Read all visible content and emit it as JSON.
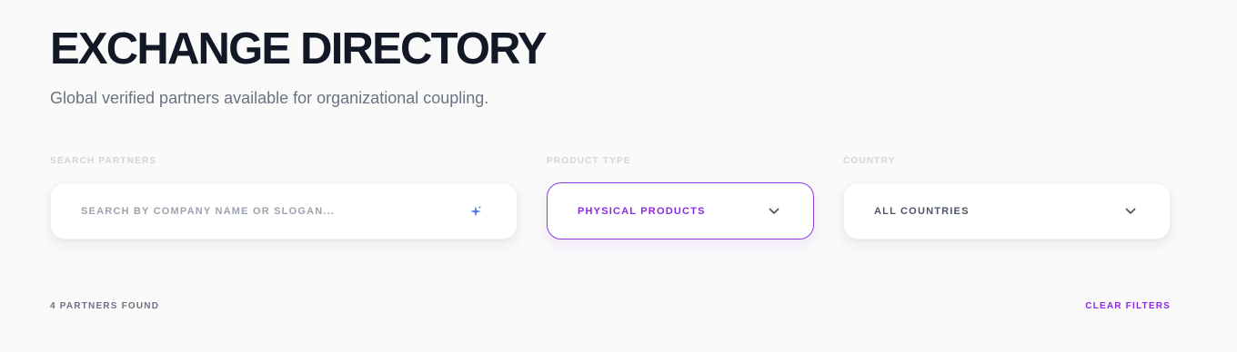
{
  "header": {
    "title": "EXCHANGE DIRECTORY",
    "subtitle": "Global verified partners available for organizational coupling."
  },
  "filters": {
    "search": {
      "label": "SEARCH PARTNERS",
      "placeholder": "SEARCH BY COMPANY NAME OR SLOGAN...",
      "icon": "sparkle-icon"
    },
    "product_type": {
      "label": "PRODUCT TYPE",
      "selected": "PHYSICAL PRODUCTS",
      "icon": "chevron-down-icon"
    },
    "country": {
      "label": "COUNTRY",
      "selected": "ALL COUNTRIES",
      "icon": "chevron-down-icon"
    }
  },
  "results": {
    "count_text": "4 PARTNERS FOUND",
    "clear_label": "CLEAR FILTERS"
  },
  "colors": {
    "accent": "#8a2be2",
    "title": "#121826",
    "sparkle": "#4f7be0"
  }
}
